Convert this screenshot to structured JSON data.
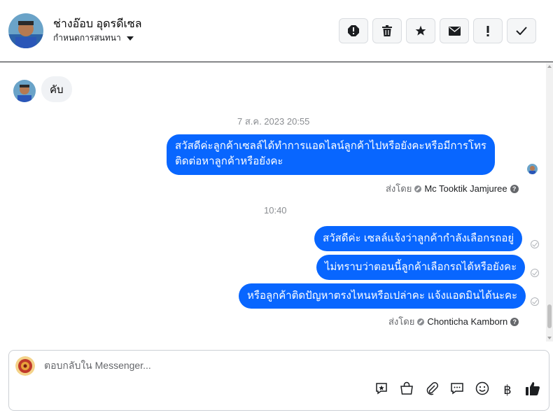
{
  "header": {
    "contact_name": "ช่างอ๊อบ อุดรดีเซล",
    "assign_label": "กำหนดการสนทนา"
  },
  "toolbar": {
    "icons": [
      "spam-icon",
      "trash-icon",
      "star-icon",
      "mail-icon",
      "important-icon",
      "check-icon"
    ]
  },
  "thread": {
    "incoming_message": "คับ",
    "group1": {
      "timestamp": "7 ส.ค. 2023 20:55",
      "messages": [
        "สวัสดีค่ะลูกค้าเซลล์ได้ทำการแอดไลน์ลูกค้าไปหรือยังคะหรือมีการโทร",
        "ติดต่อหาลูกค้าหรือยังคะ"
      ],
      "sent_by_label": "ส่งโดย",
      "sender_name": "Mc Tooktik Jamjuree"
    },
    "group2": {
      "timestamp": "10:40",
      "messages": [
        "สวัสดีค่ะ เซลล์แจ้งว่าลูกค้ากำลังเลือกรถอยู่",
        "ไม่ทราบว่าตอนนี้ลูกค้าเลือกรถได้หรือยังคะ",
        "หรือลูกค้าติดปัญหาตรงไหนหรือเปล่าคะ แจ้งแอดมินได้นะคะ"
      ],
      "sent_by_label": "ส่งโดย",
      "sender_name": "Chonticha Kamborn"
    }
  },
  "composer": {
    "placeholder": "ตอบกลับใน Messenger...",
    "tool_icons": [
      "saved-reply-icon",
      "shop-icon",
      "attach-icon",
      "chat-bubble-icon",
      "emoji-icon",
      "baht-icon",
      "like-icon"
    ],
    "baht_symbol": "฿"
  },
  "colors": {
    "outgoing_bubble": "#0866ff",
    "incoming_bubble": "#f0f2f5"
  }
}
